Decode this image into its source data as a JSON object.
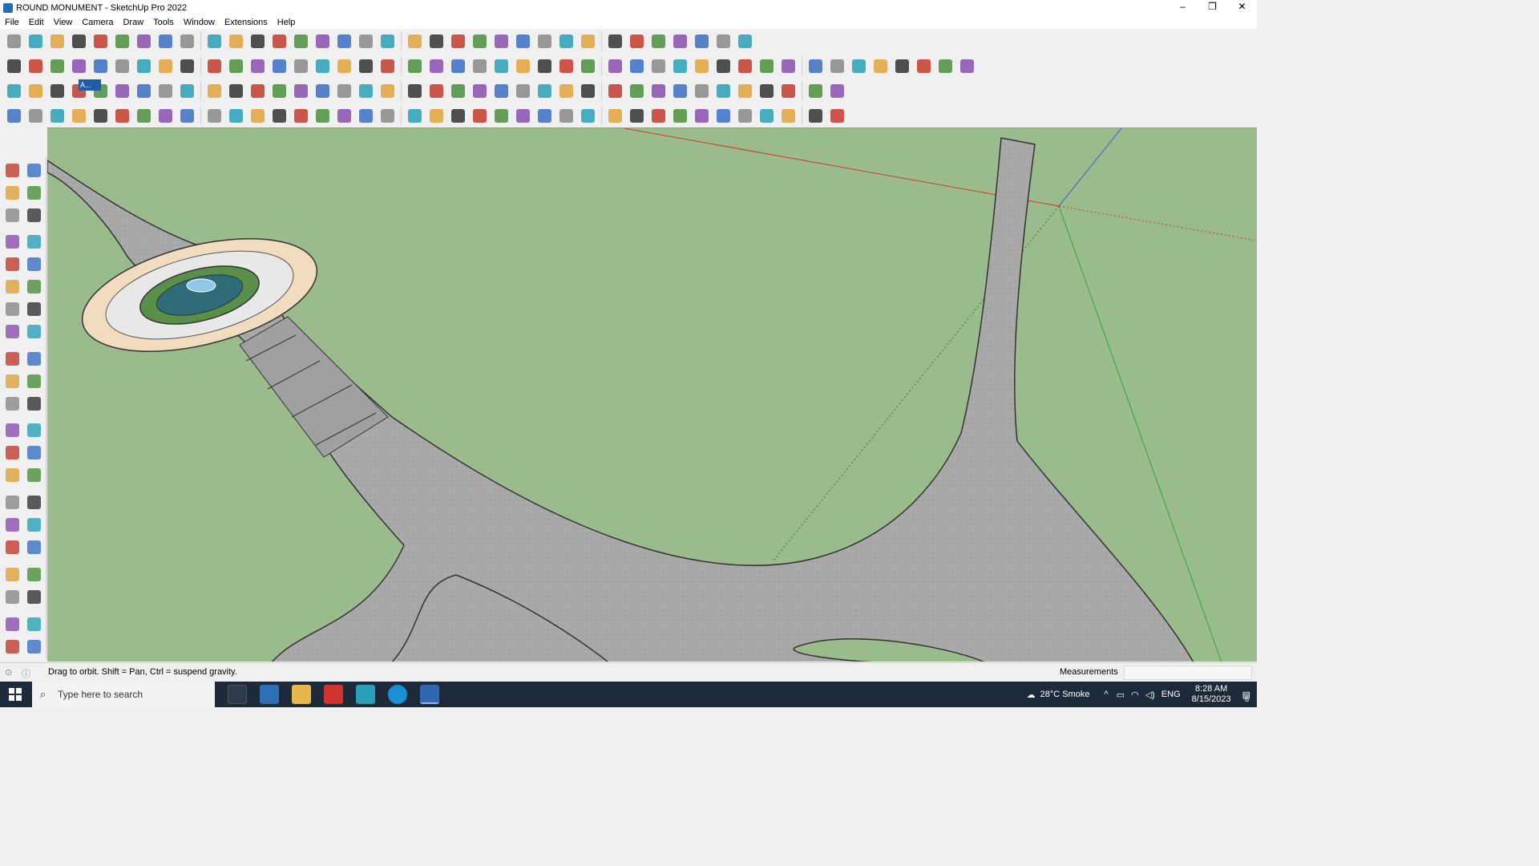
{
  "window": {
    "title": "ROUND MONUMENT - SketchUp Pro 2022",
    "minimize": "–",
    "restore": "❐",
    "close": "✕"
  },
  "menu": [
    "File",
    "Edit",
    "View",
    "Camera",
    "Draw",
    "Tools",
    "Window",
    "Extensions",
    "Help"
  ],
  "toolbar_popup_label": "A...",
  "status": {
    "hint": "Drag to orbit. Shift = Pan, Ctrl = suspend gravity.",
    "measurements_label": "Measurements",
    "measurements_value": ""
  },
  "taskbar": {
    "search_placeholder": "Type here to search",
    "weather": "28°C Smoke",
    "language": "ENG",
    "time": "8:28 AM",
    "date": "8/15/2023",
    "notifications": "6"
  },
  "colors": {
    "ground": "#9abb8c",
    "path": "#a9a9a9",
    "axis_red": "#cc3a2f",
    "axis_green": "#2fa53a",
    "axis_blue": "#3b5bd6",
    "plaza": "#f2dcc0",
    "lawn": "#5a8f4a",
    "water": "#8fc8e8"
  }
}
